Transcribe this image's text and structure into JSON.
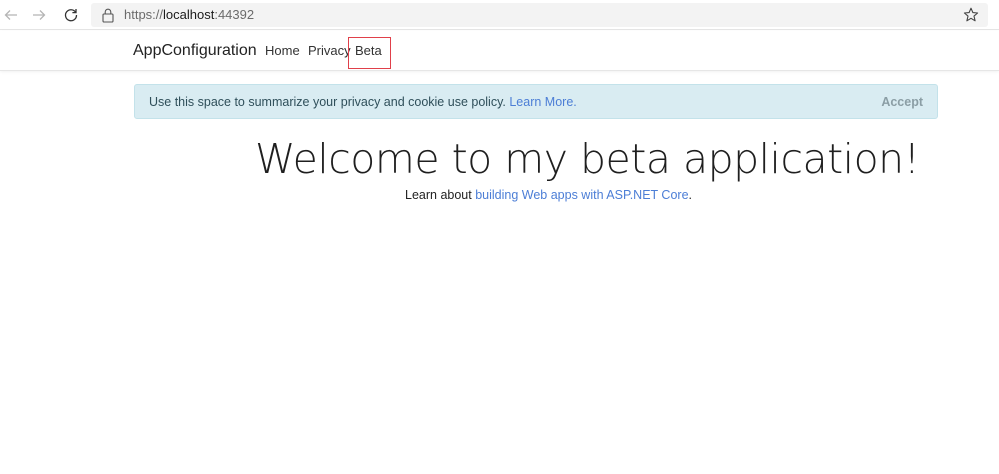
{
  "browser": {
    "url_scheme": "https://",
    "url_host": "localhost",
    "url_port": ":44392"
  },
  "navbar": {
    "brand": "AppConfiguration",
    "links": [
      {
        "label": "Home"
      },
      {
        "label": "Privacy"
      },
      {
        "label": "Beta"
      }
    ]
  },
  "cookie_alert": {
    "message": "Use this space to summarize your privacy and cookie use policy. ",
    "learn_more": "Learn More.",
    "accept": "Accept"
  },
  "main": {
    "heading": "Welcome to my beta application!",
    "learn_prefix": "Learn about ",
    "learn_link": "building Web apps with ASP.NET Core",
    "learn_suffix": "."
  },
  "colors": {
    "link": "#4c7ed6",
    "alert_bg": "#d9ecf2",
    "highlight": "#e0404a"
  }
}
